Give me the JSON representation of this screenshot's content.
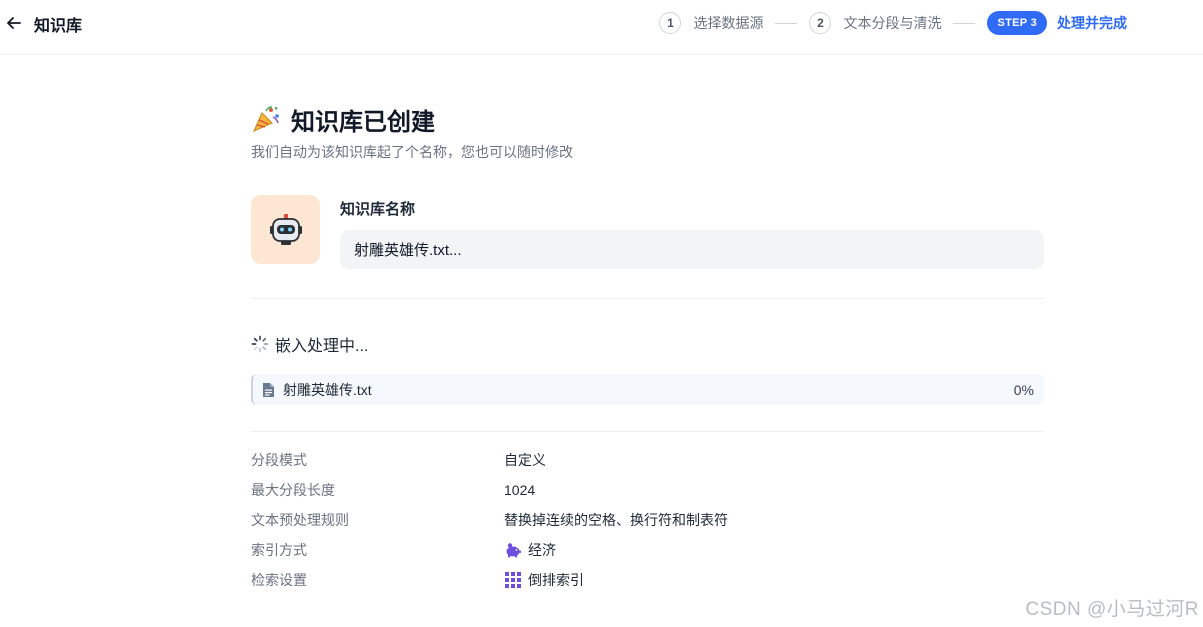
{
  "header": {
    "title": "知识库",
    "steps": [
      {
        "num": "1",
        "label": "选择数据源"
      },
      {
        "num": "2",
        "label": "文本分段与清洗"
      },
      {
        "badge": "STEP 3",
        "label": "处理并完成"
      }
    ]
  },
  "main": {
    "title": "知识库已创建",
    "subtitle": "我们自动为该知识库起了个名称，您也可以随时修改",
    "name_label": "知识库名称",
    "name_value": "射雕英雄传.txt...",
    "processing_text": "嵌入处理中...",
    "file": {
      "name": "射雕英雄传.txt",
      "progress": "0%"
    },
    "settings": [
      {
        "label": "分段模式",
        "value": "自定义"
      },
      {
        "label": "最大分段长度",
        "value": "1024"
      },
      {
        "label": "文本预处理规则",
        "value": "替换掉连续的空格、换行符和制表符"
      },
      {
        "label": "索引方式",
        "value": "经济",
        "icon": "piggy-bank-icon"
      },
      {
        "label": "检索设置",
        "value": "倒排索引",
        "icon": "grid-icon"
      }
    ]
  },
  "watermark": "CSDN @小马过河R",
  "colors": {
    "accent": "#2f6bf6",
    "avatar_bg": "#fde7d2",
    "input_bg": "#f3f4f6",
    "icon_purple": "#6d4fe0"
  }
}
